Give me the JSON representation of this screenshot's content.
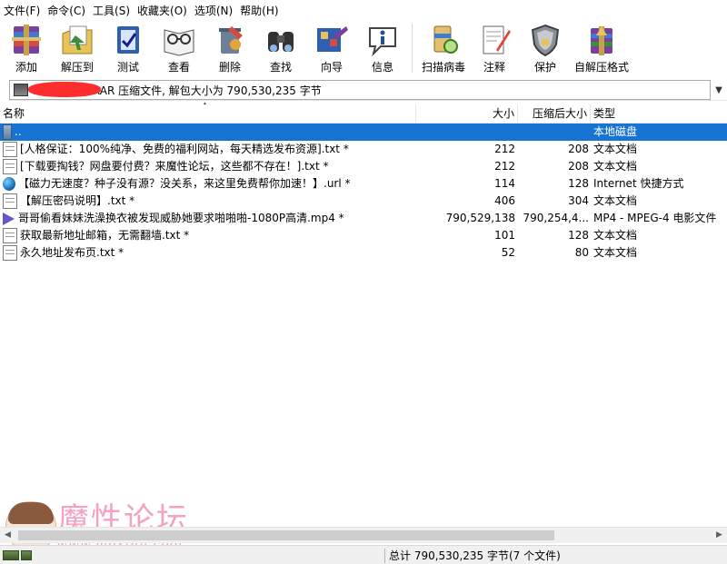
{
  "menu": [
    "文件(F)",
    "命令(C)",
    "工具(S)",
    "收藏夹(O)",
    "选项(N)",
    "帮助(H)"
  ],
  "toolbar": [
    {
      "label": "添加",
      "icon": "add-archive-icon"
    },
    {
      "label": "解压到",
      "icon": "extract-to-icon"
    },
    {
      "label": "测试",
      "icon": "test-icon"
    },
    {
      "label": "查看",
      "icon": "view-icon"
    },
    {
      "label": "删除",
      "icon": "delete-icon"
    },
    {
      "label": "查找",
      "icon": "find-icon"
    },
    {
      "label": "向导",
      "icon": "wizard-icon"
    },
    {
      "label": "信息",
      "icon": "info-icon"
    },
    {
      "label": "扫描病毒",
      "icon": "virus-scan-icon"
    },
    {
      "label": "注释",
      "icon": "comment-icon"
    },
    {
      "label": "保护",
      "icon": "protect-icon"
    },
    {
      "label": "自解压格式",
      "icon": "sfx-icon"
    }
  ],
  "address": {
    "text": "r - RAR 压缩文件, 解包大小为 790,530,235 字节"
  },
  "columns": {
    "name": "名称",
    "size": "大小",
    "packed": "压缩后大小",
    "type": "类型"
  },
  "files": [
    {
      "icon": "up-folder-icon",
      "name": "..",
      "size": "",
      "packed": "",
      "type": "本地磁盘",
      "selected": true
    },
    {
      "icon": "text-file-icon",
      "name": "[人格保证：100%纯净、免费的福利网站，每天精选发布资源].txt *",
      "size": "212",
      "packed": "208",
      "type": "文本文档",
      "selected": false
    },
    {
      "icon": "text-file-icon",
      "name": "[下载要掏钱？网盘要付费？来魔性论坛，这些都不存在！].txt *",
      "size": "212",
      "packed": "208",
      "type": "文本文档",
      "selected": false
    },
    {
      "icon": "internet-shortcut-icon",
      "name": "【磁力无速度？种子没有源？没关系，来这里免费帮你加速！】.url *",
      "size": "114",
      "packed": "128",
      "type": "Internet 快捷方式",
      "selected": false
    },
    {
      "icon": "text-file-icon",
      "name": "【解压密码说明】.txt *",
      "size": "406",
      "packed": "304",
      "type": "文本文档",
      "selected": false
    },
    {
      "icon": "video-file-icon",
      "name": "哥哥偷看妹妹洗澡换衣被发现威胁她要求啪啪啪-1080P高清.mp4 *",
      "size": "790,529,138",
      "packed": "790,254,4...",
      "type": "MP4 - MPEG-4 电影文件",
      "selected": false
    },
    {
      "icon": "text-file-icon",
      "name": "获取最新地址邮箱，无需翻墙.txt *",
      "size": "101",
      "packed": "128",
      "type": "文本文档",
      "selected": false
    },
    {
      "icon": "text-file-icon",
      "name": "永久地址发布页.txt *",
      "size": "52",
      "packed": "80",
      "type": "文本文档",
      "selected": false
    }
  ],
  "status": {
    "total": "总计 790,530,235 字节(7 个文件)"
  },
  "watermark": {
    "title": "魔性论坛",
    "url": "www.moxing.cool"
  },
  "colors": {
    "selection": "#1874d2",
    "watermark": "#f3a2c2"
  }
}
